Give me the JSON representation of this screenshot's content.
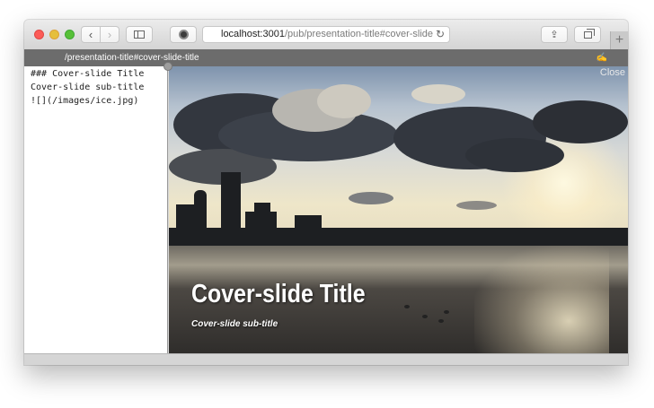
{
  "browser": {
    "url_host": "localhost:3001",
    "url_path": "/pub/presentation-title#cover-slide",
    "buttons": {
      "back_icon": "chevron-left-icon",
      "forward_icon": "chevron-right-icon",
      "sidebar_icon": "sidebar-icon",
      "extension_icon": "extension-icon",
      "reload_icon": "reload-icon",
      "share_icon": "share-icon",
      "tabs_icon": "tabs-icon",
      "newtab_label": "+"
    },
    "glyphs": {
      "back": "‹",
      "forward": "›",
      "reload": "↻",
      "share": "⇪"
    }
  },
  "pathbar": {
    "path": "/presentation-title#cover-slide-title",
    "edit_icon": "pencil-icon",
    "edit_glyph": "✍"
  },
  "editor": {
    "lines": [
      "### Cover-slide Title",
      "Cover-slide sub-title",
      "![](/images/ice.jpg)"
    ]
  },
  "preview": {
    "close_label": "Close",
    "title": "Cover-slide Title",
    "subtitle": "Cover-slide sub-title"
  }
}
